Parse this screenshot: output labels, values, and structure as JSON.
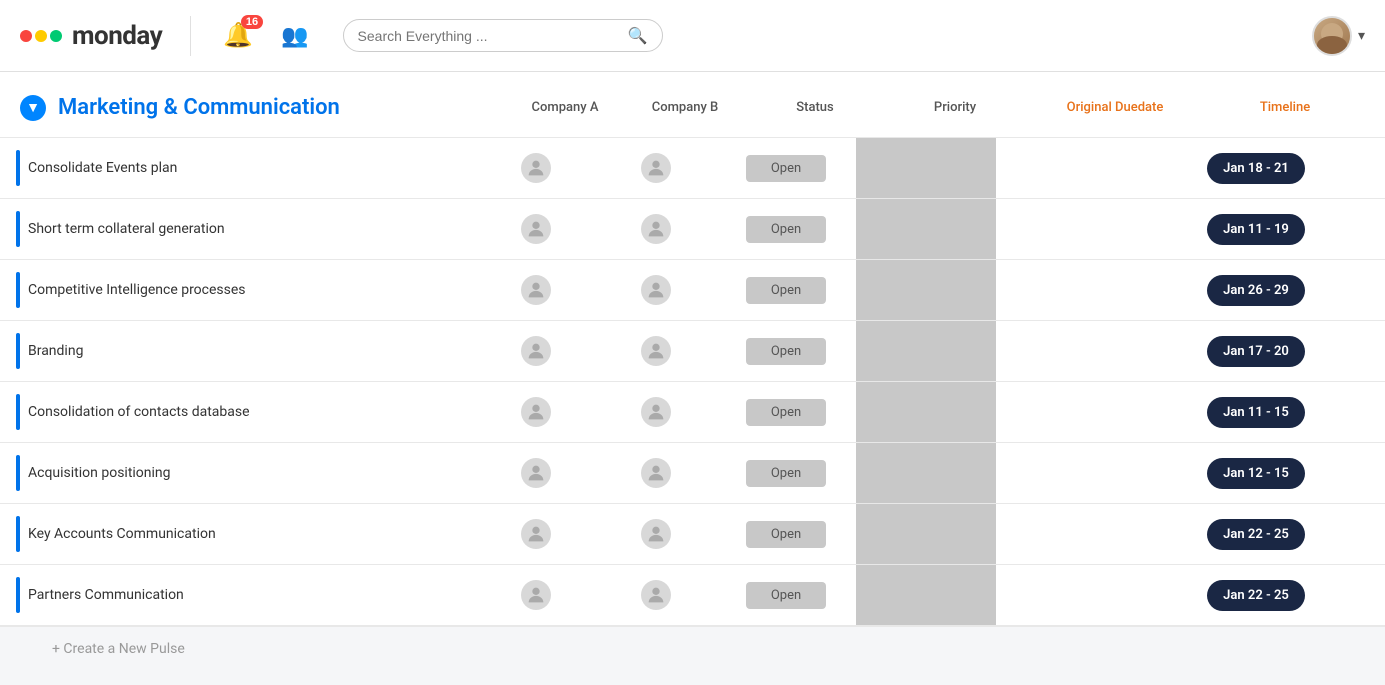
{
  "header": {
    "logo_text": "monday",
    "notification_count": "16",
    "search_placeholder": "Search Everything ...",
    "search_icon": "🔍"
  },
  "board": {
    "title": "Marketing & Communication",
    "expand_icon": "▼",
    "columns": [
      {
        "key": "task",
        "label": "",
        "style": "task-col"
      },
      {
        "key": "company_a",
        "label": "Company A",
        "style": ""
      },
      {
        "key": "company_b",
        "label": "Company B",
        "style": ""
      },
      {
        "key": "status",
        "label": "Status",
        "style": ""
      },
      {
        "key": "priority",
        "label": "Priority",
        "style": ""
      },
      {
        "key": "duedate",
        "label": "Original Duedate",
        "style": "original-duedate"
      },
      {
        "key": "timeline",
        "label": "Timeline",
        "style": "timeline-col"
      }
    ],
    "rows": [
      {
        "task": "Consolidate Events plan",
        "status": "Open",
        "timeline": "Jan 18 - 21"
      },
      {
        "task": "Short term collateral generation",
        "status": "Open",
        "timeline": "Jan 11 - 19"
      },
      {
        "task": "Competitive Intelligence processes",
        "status": "Open",
        "timeline": "Jan 26 - 29"
      },
      {
        "task": "Branding",
        "status": "Open",
        "timeline": "Jan 17 - 20"
      },
      {
        "task": "Consolidation of contacts database",
        "status": "Open",
        "timeline": "Jan 11 - 15"
      },
      {
        "task": "Acquisition positioning",
        "status": "Open",
        "timeline": "Jan 12 - 15"
      },
      {
        "task": "Key Accounts Communication",
        "status": "Open",
        "timeline": "Jan 22 - 25"
      },
      {
        "task": "Partners Communication",
        "status": "Open",
        "timeline": "Jan 22 - 25"
      }
    ],
    "create_pulse_label": "+ Create a New Pulse"
  },
  "colors": {
    "accent_blue": "#0073ea",
    "dark_navy": "#1a2744",
    "status_gray": "#c8c8c8",
    "priority_gray": "#c8c8c8"
  }
}
